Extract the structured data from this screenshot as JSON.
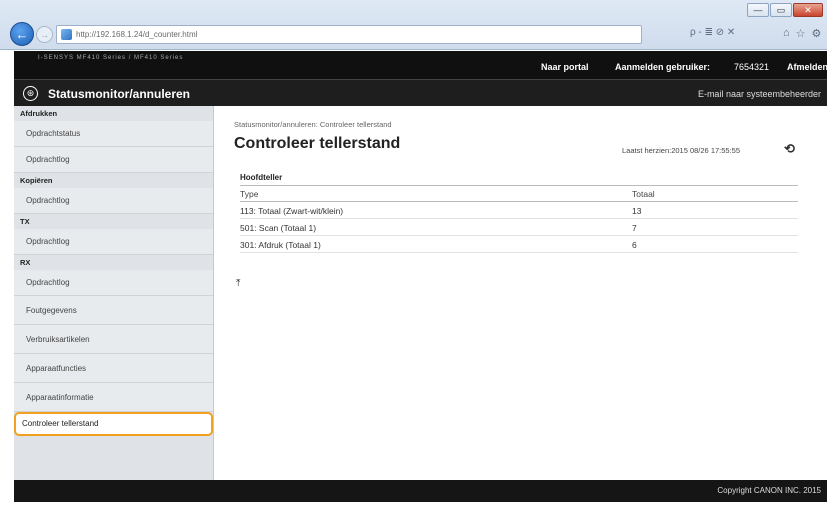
{
  "browser": {
    "url": "http://192.168.1.24/d_counter.html",
    "search_glyph": "ρ - ≣ ⊘ ✕",
    "window_controls": [
      "—",
      "▭",
      "✕"
    ],
    "toolbar_icons": [
      "⌂",
      "☆",
      "⚙"
    ],
    "back_glyph": "←",
    "forward_glyph": "→"
  },
  "topbar": {
    "model": "I-SENSYS  MF410 Series / MF410 Series",
    "portal": "Naar portal",
    "login_label": "Aanmelden gebruiker:",
    "user": "7654321",
    "logout": "Afmelden"
  },
  "titlebar": {
    "logo_glyph": "⊛",
    "app_title": "Statusmonitor/annuleren",
    "email": "E-mail naar systeembeheerder"
  },
  "sidebar": {
    "sections": [
      {
        "heading": "Afdrukken",
        "items": [
          "Opdrachtstatus",
          "Opdrachtlog"
        ]
      },
      {
        "heading": "Kopiëren",
        "items": [
          "Opdrachtlog"
        ]
      },
      {
        "heading": "TX",
        "items": [
          "Opdrachtlog"
        ]
      },
      {
        "heading": "RX",
        "items": [
          "Opdrachtlog"
        ]
      }
    ],
    "single_items": [
      "Foutgegevens",
      "Verbruiksartikelen",
      "Apparaatfuncties",
      "Apparaatinformatie"
    ],
    "active_item": "Controleer tellerstand"
  },
  "main": {
    "breadcrumb": "Statusmonitor/annuleren: Controleer tellerstand",
    "title": "Controleer tellerstand",
    "updated": "Laatst herzien:2015 08/26 17:55:55",
    "refresh_glyph": "⟲",
    "section_title": "Hoofdteller",
    "columns": [
      "Type",
      "Totaal"
    ],
    "rows": [
      {
        "type": "113: Totaal (Zwart-wit/klein)",
        "total": "13"
      },
      {
        "type": "501: Scan (Totaal 1)",
        "total": "7"
      },
      {
        "type": "301: Afdruk (Totaal 1)",
        "total": "6"
      }
    ],
    "top_glyph": "⤒"
  },
  "footer": {
    "copyright": "Copyright CANON INC. 2015"
  }
}
